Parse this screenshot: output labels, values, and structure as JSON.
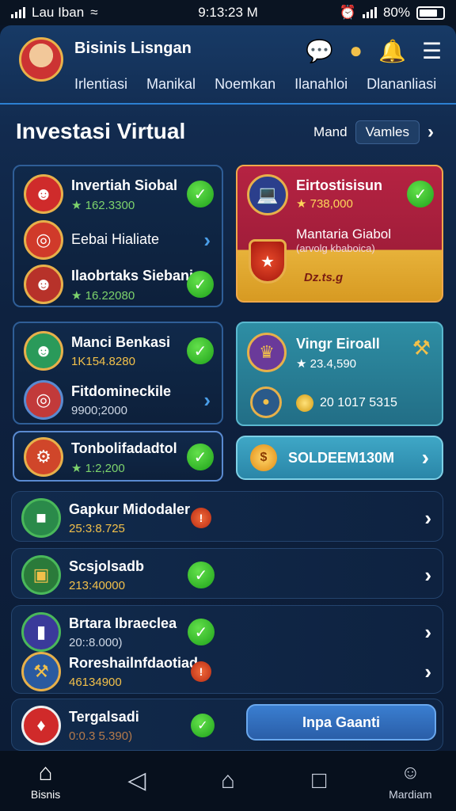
{
  "status_bar": {
    "carrier": "Lau Iban",
    "time": "9:13:23 M",
    "battery": "80%"
  },
  "header": {
    "title": "Bisinis Lisngan",
    "tabs": [
      "Irlentiasi",
      "Manikal",
      "Noemkan",
      "Ilanahloi",
      "Dlananliasi"
    ]
  },
  "section": {
    "title": "Investasi Virtual",
    "segment_left": "Mand",
    "segment_right": "Vamles"
  },
  "card_top_left": {
    "rows": [
      {
        "title": "Invertiah Siobal",
        "sub": "★ 162.3300"
      },
      {
        "title": "Eebai Hialiate",
        "sub": ""
      },
      {
        "title": "Ilaobrtaks Siebani",
        "sub": "★ 16.22080"
      }
    ]
  },
  "card_top_right": {
    "title": "Eirtostisisun",
    "sub": "★ 738,000",
    "line1": "Mantaria Giabol",
    "line2": "(arvolg kbaboica)",
    "tag": "Dz.ts.g"
  },
  "card_mid_left": {
    "rows": [
      {
        "title": "Manci Benkasi",
        "sub": "1K154.8280"
      },
      {
        "title": "Fitdomineckile",
        "sub": "9900;2000"
      }
    ]
  },
  "card_mid_right": {
    "title": "Vingr Eiroall",
    "sub": "★ 23.4,590",
    "coin_value": "20 1017 5315"
  },
  "card_single": {
    "title": "Tonbolifadadtol",
    "sub": "★ 1:2,200"
  },
  "gold_button": {
    "label": "SOLDEEM130M"
  },
  "list": [
    {
      "title": "Gapkur Midodaler",
      "sub": "25:3:8.725"
    },
    {
      "title": "Scsjolsadb",
      "sub": "213:40000"
    },
    {
      "title": "Brtara Ibraeclea",
      "sub": "20::8.000)"
    },
    {
      "title": "Roreshailnfdaotiad",
      "sub": "46134900"
    },
    {
      "title": "Tergalsadi",
      "sub": "0:0.3 5.390)"
    }
  ],
  "action_button": {
    "label": "Inpa Gaanti"
  },
  "bottom_nav": {
    "left_label": "Bisnis",
    "right_label": "Mardiam"
  },
  "colors": {
    "accent_blue": "#2c7fd1",
    "gold": "#f2c04a",
    "green": "#1ea11a",
    "red_card": "#b52342",
    "teal_card": "#2e8ea4"
  }
}
